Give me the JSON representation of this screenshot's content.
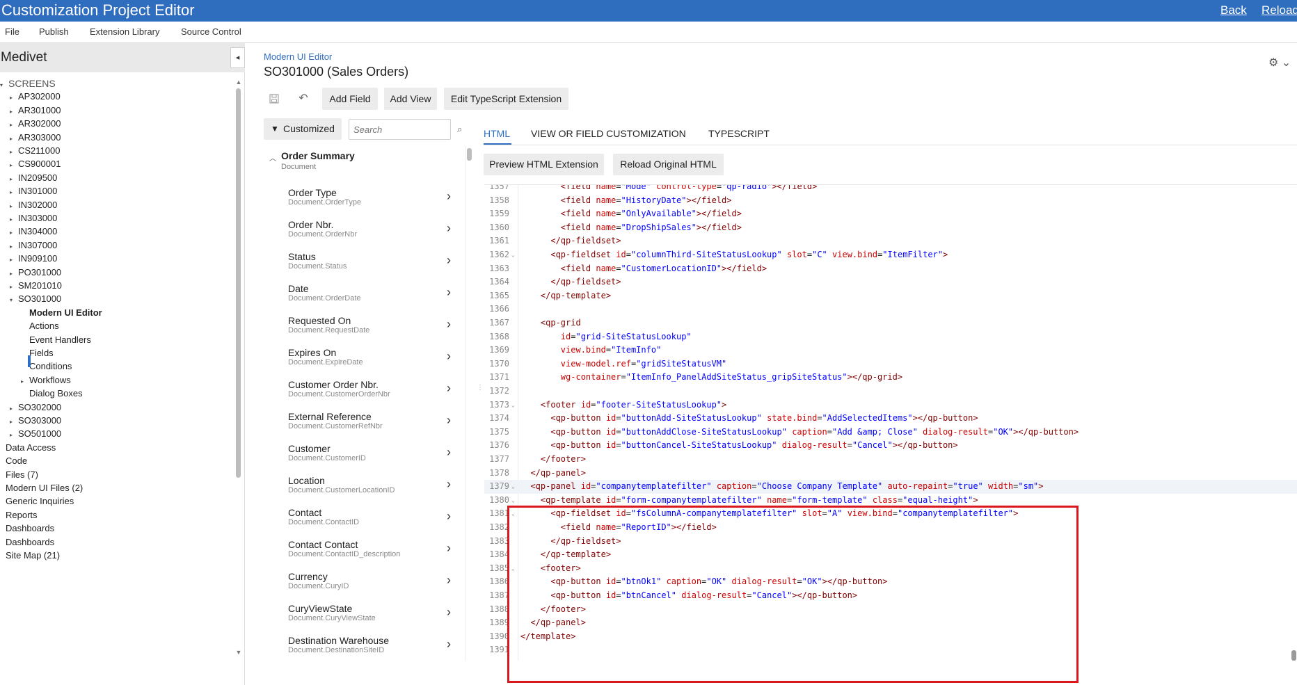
{
  "titlebar": {
    "title": "Customization Project Editor",
    "back": "Back",
    "reload": "Reload"
  },
  "menu": [
    "File",
    "Publish",
    "Extension Library",
    "Source Control"
  ],
  "sidebar": {
    "project": "Medivet",
    "collapse_glyph": "◂",
    "root": "SCREENS",
    "screens": [
      "AP302000",
      "AR301000",
      "AR302000",
      "AR303000",
      "CS211000",
      "CS900001",
      "IN209500",
      "IN301000",
      "IN302000",
      "IN303000",
      "IN304000",
      "IN307000",
      "IN909100",
      "PO301000",
      "SM201010",
      "SO301000"
    ],
    "so_children": [
      "Modern UI Editor",
      "Actions",
      "Event Handlers",
      "Fields",
      "Conditions",
      "Workflows",
      "Dialog Boxes"
    ],
    "more_screens": [
      "SO302000",
      "SO303000",
      "SO501000"
    ],
    "sections": [
      "Data Access",
      "Code",
      "Files (7)",
      "Modern UI Files (2)",
      "Generic Inquiries",
      "Reports",
      "Dashboards",
      "Dashboards",
      "Site Map (21)"
    ]
  },
  "content": {
    "breadcrumb": "Modern UI Editor",
    "title": "SO301000 (Sales Orders)",
    "toolbar": {
      "add_field": "Add Field",
      "add_view": "Add View",
      "edit_ts": "Edit TypeScript Extension"
    },
    "filter": "Customized",
    "search_placeholder": "Search"
  },
  "fields": {
    "group": {
      "name": "Order Summary",
      "sub": "Document"
    },
    "items": [
      {
        "name": "Order Type",
        "sub": "Document.OrderType"
      },
      {
        "name": "Order Nbr.",
        "sub": "Document.OrderNbr"
      },
      {
        "name": "Status",
        "sub": "Document.Status"
      },
      {
        "name": "Date",
        "sub": "Document.OrderDate"
      },
      {
        "name": "Requested On",
        "sub": "Document.RequestDate"
      },
      {
        "name": "Expires On",
        "sub": "Document.ExpireDate"
      },
      {
        "name": "Customer Order Nbr.",
        "sub": "Document.CustomerOrderNbr"
      },
      {
        "name": "External Reference",
        "sub": "Document.CustomerRefNbr"
      },
      {
        "name": "Customer",
        "sub": "Document.CustomerID"
      },
      {
        "name": "Location",
        "sub": "Document.CustomerLocationID"
      },
      {
        "name": "Contact",
        "sub": "Document.ContactID"
      },
      {
        "name": "Contact Contact",
        "sub": "Document.ContactID_description"
      },
      {
        "name": "Currency",
        "sub": "Document.CuryID"
      },
      {
        "name": "CuryViewState",
        "sub": "Document.CuryViewState"
      },
      {
        "name": "Destination Warehouse",
        "sub": "Document.DestinationSiteID"
      }
    ]
  },
  "editor": {
    "tabs": [
      "HTML",
      "VIEW OR FIELD CUSTOMIZATION",
      "TYPESCRIPT"
    ],
    "preview_btn": "Preview HTML Extension",
    "reload_btn": "Reload Original HTML",
    "current_line": 1379,
    "lines": [
      {
        "n": 1357,
        "t": "        <field name=\"Mode\" control-type=\"qp-radio\"></field>"
      },
      {
        "n": 1358,
        "t": "        <field name=\"HistoryDate\"></field>"
      },
      {
        "n": 1359,
        "t": "        <field name=\"OnlyAvailable\"></field>"
      },
      {
        "n": 1360,
        "t": "        <field name=\"DropShipSales\"></field>"
      },
      {
        "n": 1361,
        "t": "      </qp-fieldset>"
      },
      {
        "n": 1362,
        "t": "      <qp-fieldset id=\"columnThird-SiteStatusLookup\" slot=\"C\" view.bind=\"ItemFilter\">",
        "fold": true
      },
      {
        "n": 1363,
        "t": "        <field name=\"CustomerLocationID\"></field>"
      },
      {
        "n": 1364,
        "t": "      </qp-fieldset>"
      },
      {
        "n": 1365,
        "t": "    </qp-template>"
      },
      {
        "n": 1366,
        "t": ""
      },
      {
        "n": 1367,
        "t": "    <qp-grid"
      },
      {
        "n": 1368,
        "t": "        id=\"grid-SiteStatusLookup\""
      },
      {
        "n": 1369,
        "t": "        view.bind=\"ItemInfo\""
      },
      {
        "n": 1370,
        "t": "        view-model.ref=\"gridSiteStatusVM\""
      },
      {
        "n": 1371,
        "t": "        wg-container=\"ItemInfo_PanelAddSiteStatus_gripSiteStatus\"></qp-grid>"
      },
      {
        "n": 1372,
        "t": ""
      },
      {
        "n": 1373,
        "t": "    <footer id=\"footer-SiteStatusLookup\">",
        "fold": true
      },
      {
        "n": 1374,
        "t": "      <qp-button id=\"buttonAdd-SiteStatusLookup\" state.bind=\"AddSelectedItems\"></qp-button>"
      },
      {
        "n": 1375,
        "t": "      <qp-button id=\"buttonAddClose-SiteStatusLookup\" caption=\"Add &amp; Close\" dialog-result=\"OK\"></qp-button>"
      },
      {
        "n": 1376,
        "t": "      <qp-button id=\"buttonCancel-SiteStatusLookup\" dialog-result=\"Cancel\"></qp-button>"
      },
      {
        "n": 1377,
        "t": "    </footer>"
      },
      {
        "n": 1378,
        "t": "  </qp-panel>"
      },
      {
        "n": 1379,
        "t": "  <qp-panel id=\"companytemplatefilter\" caption=\"Choose Company Template\" auto-repaint=\"true\" width=\"sm\">",
        "fold": true
      },
      {
        "n": 1380,
        "t": "    <qp-template id=\"form-companytemplatefilter\" name=\"form-template\" class=\"equal-height\">",
        "fold": true
      },
      {
        "n": 1381,
        "t": "      <qp-fieldset id=\"fsColumnA-companytemplatefilter\" slot=\"A\" view.bind=\"companytemplatefilter\">",
        "fold": true
      },
      {
        "n": 1382,
        "t": "        <field name=\"ReportID\"></field>"
      },
      {
        "n": 1383,
        "t": "      </qp-fieldset>"
      },
      {
        "n": 1384,
        "t": "    </qp-template>"
      },
      {
        "n": 1385,
        "t": "    <footer>",
        "fold": true
      },
      {
        "n": 1386,
        "t": "      <qp-button id=\"btnOk1\" caption=\"OK\" dialog-result=\"OK\"></qp-button>"
      },
      {
        "n": 1387,
        "t": "      <qp-button id=\"btnCancel\" dialog-result=\"Cancel\"></qp-button>"
      },
      {
        "n": 1388,
        "t": "    </footer>"
      },
      {
        "n": 1389,
        "t": "  </qp-panel>"
      },
      {
        "n": 1390,
        "t": "</template>"
      },
      {
        "n": 1391,
        "t": ""
      }
    ]
  },
  "colors": {
    "accent": "#2f6dbe",
    "highlight": "#d9171c",
    "tag": "#800000",
    "attr": "#cc0000",
    "value": "#0000ff"
  },
  "icons": [
    "collapse-sidebar-icon",
    "save-icon",
    "undo-icon",
    "filter-icon",
    "search-icon",
    "gear-icon",
    "chevron-right-icon",
    "fold-icon"
  ]
}
